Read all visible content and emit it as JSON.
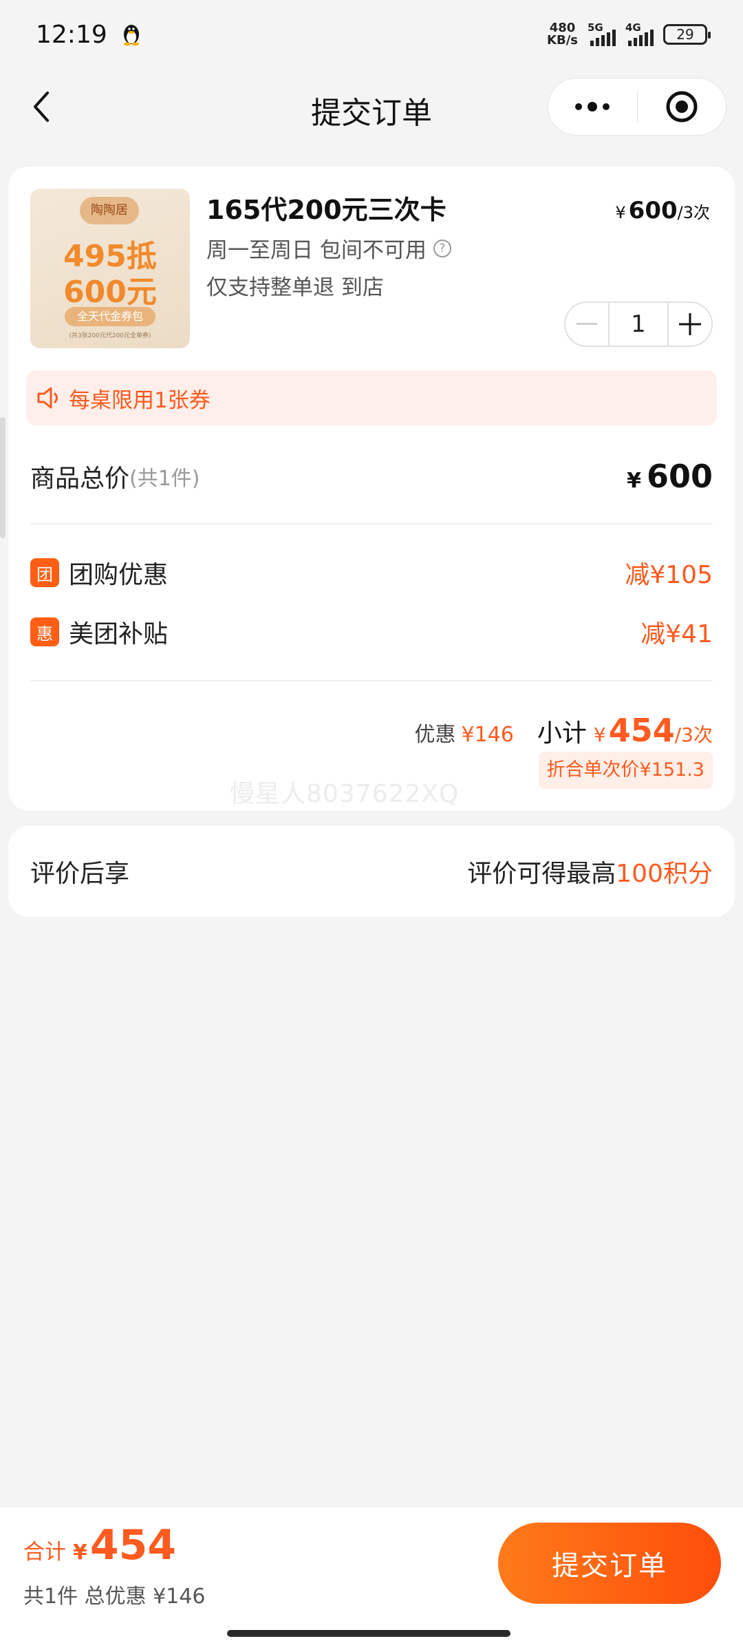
{
  "status_bar": {
    "time": "12:19",
    "net_speed_value": "480",
    "net_speed_unit": "KB/s",
    "signal1_label": "5G",
    "signal2_label": "4G",
    "battery": "29"
  },
  "nav": {
    "title": "提交订单"
  },
  "product": {
    "title": "165代200元三次卡",
    "desc_line1": "周一至周日 包间不可用",
    "desc_line2": "仅支持整单退 到店",
    "currency": "¥",
    "unit_price": "600",
    "unit_suffix": "/3次",
    "quantity": "1",
    "image_text": {
      "seal": "陶陶居",
      "line1": "495抵",
      "line2": "600元",
      "pill": "全天代金券包",
      "fine_print": "(共3张200元代200元全单券)"
    }
  },
  "notice": {
    "text": "每桌限用1张券"
  },
  "summary": {
    "total_label": "商品总价",
    "total_count": "(共1件)",
    "total_currency": "¥",
    "total_value": "600",
    "discounts": [
      {
        "badge": "团",
        "label": "团购优惠",
        "amount": "减¥105"
      },
      {
        "badge": "惠",
        "label": "美团补贴",
        "amount": "减¥41"
      }
    ],
    "youhui_label": "优惠",
    "youhui_value": "¥146",
    "subtotal_label": "小计",
    "subtotal_currency": "¥",
    "subtotal_value": "454",
    "subtotal_unit": "/3次",
    "per_use_price": "折合单次价¥151.3",
    "watermark": "慢星人8037622XQ"
  },
  "review": {
    "label": "评价后享",
    "right_prefix": "评价可得最高",
    "points": "100积分"
  },
  "bottom": {
    "sum_label": "合计",
    "sum_currency": "¥",
    "sum_value": "454",
    "detail": "共1件 总优惠 ¥146",
    "submit_label": "提交订单"
  },
  "colors": {
    "accent": "#ff5a1f",
    "button_gradient_start": "#ff7a1a",
    "button_gradient_end": "#ff4e0a",
    "notice_bg": "#ffefea",
    "page_bg": "#f4f4f4"
  }
}
